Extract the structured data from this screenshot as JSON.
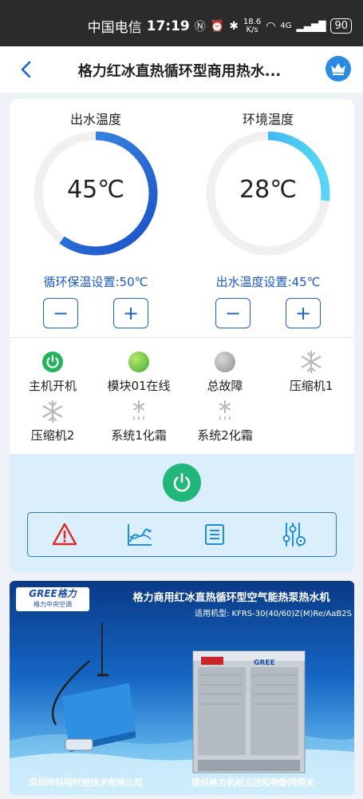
{
  "status_bar": {
    "carrier": "中国电信",
    "time": "17:19",
    "speed_value": "18.6",
    "speed_unit": "K/s",
    "network": "4G",
    "battery": "90"
  },
  "nav": {
    "title": "格力红冰直热循环型商用热水..."
  },
  "gauges": [
    {
      "label": "出水温度",
      "value": "45℃",
      "setpoint": "循环保温设置:50℃",
      "fill": 0.6,
      "color_start": "#1e50c8",
      "color_end": "#3a8ee8"
    },
    {
      "label": "环境温度",
      "value": "28℃",
      "setpoint": "出水温度设置:45℃",
      "fill": 0.27,
      "color_start": "#2a9ee8",
      "color_end": "#55d4f5"
    }
  ],
  "stepper": {
    "minus": "−",
    "plus": "+"
  },
  "status_items": [
    {
      "label": "主机开机",
      "icon": "power-on-icon",
      "color": "#23b35a"
    },
    {
      "label": "模块01在线",
      "icon": "online-dot-icon",
      "color": "#56c43a"
    },
    {
      "label": "总故障",
      "icon": "fault-dot-icon",
      "color": "#a7a7a7"
    },
    {
      "label": "压缩机1",
      "icon": "snowflake-icon",
      "color": "#b9b9b9"
    },
    {
      "label": "压缩机2",
      "icon": "snowflake-icon",
      "color": "#b9b9b9"
    },
    {
      "label": "系统1化霜",
      "icon": "defrost-icon",
      "color": "#b9b9b9"
    },
    {
      "label": "系统2化霜",
      "icon": "defrost-icon",
      "color": "#b9b9b9"
    }
  ],
  "toolbar": {
    "items": [
      "alarm-warning-icon",
      "curve-chart-icon",
      "list-document-icon",
      "settings-sliders-icon"
    ]
  },
  "banner": {
    "brand": "GREE格力",
    "brand_sub": "格力中央空调",
    "title": "格力商用红冰直热循环型空气能热泵热水机",
    "model": "适用机型: KFRS-30(40/60)Z(M)Re/AaB2S",
    "footer_left": "深圳市科特时控技术有限公司",
    "footer_right": "提供格力机组云控和物联网网关",
    "device_label": "GREE"
  },
  "colors": {
    "accent": "#1e63c8",
    "power_green": "#22b77a",
    "alarm_red": "#e02a2a",
    "control_bg": "#dbeefb"
  }
}
